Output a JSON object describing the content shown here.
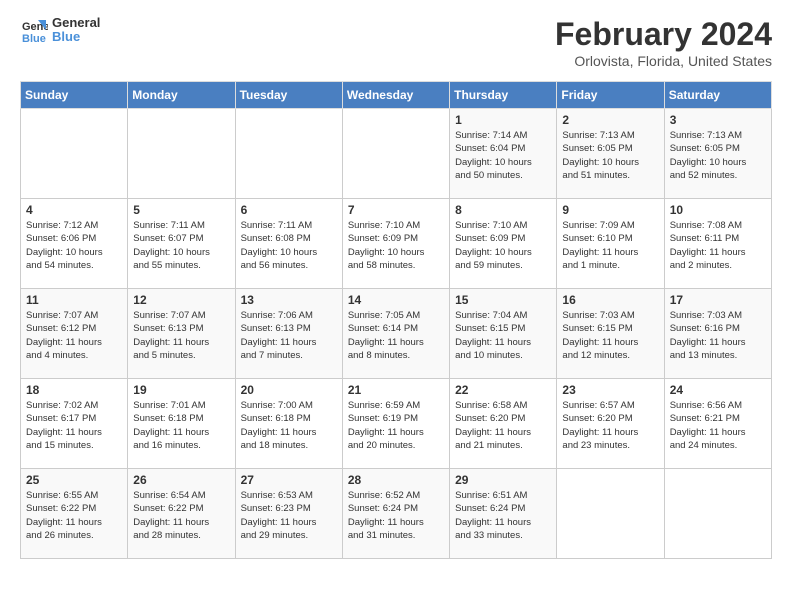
{
  "header": {
    "logo_line1": "General",
    "logo_line2": "Blue",
    "month_year": "February 2024",
    "location": "Orlovista, Florida, United States"
  },
  "days_of_week": [
    "Sunday",
    "Monday",
    "Tuesday",
    "Wednesday",
    "Thursday",
    "Friday",
    "Saturday"
  ],
  "weeks": [
    [
      {
        "num": "",
        "info": ""
      },
      {
        "num": "",
        "info": ""
      },
      {
        "num": "",
        "info": ""
      },
      {
        "num": "",
        "info": ""
      },
      {
        "num": "1",
        "info": "Sunrise: 7:14 AM\nSunset: 6:04 PM\nDaylight: 10 hours\nand 50 minutes."
      },
      {
        "num": "2",
        "info": "Sunrise: 7:13 AM\nSunset: 6:05 PM\nDaylight: 10 hours\nand 51 minutes."
      },
      {
        "num": "3",
        "info": "Sunrise: 7:13 AM\nSunset: 6:05 PM\nDaylight: 10 hours\nand 52 minutes."
      }
    ],
    [
      {
        "num": "4",
        "info": "Sunrise: 7:12 AM\nSunset: 6:06 PM\nDaylight: 10 hours\nand 54 minutes."
      },
      {
        "num": "5",
        "info": "Sunrise: 7:11 AM\nSunset: 6:07 PM\nDaylight: 10 hours\nand 55 minutes."
      },
      {
        "num": "6",
        "info": "Sunrise: 7:11 AM\nSunset: 6:08 PM\nDaylight: 10 hours\nand 56 minutes."
      },
      {
        "num": "7",
        "info": "Sunrise: 7:10 AM\nSunset: 6:09 PM\nDaylight: 10 hours\nand 58 minutes."
      },
      {
        "num": "8",
        "info": "Sunrise: 7:10 AM\nSunset: 6:09 PM\nDaylight: 10 hours\nand 59 minutes."
      },
      {
        "num": "9",
        "info": "Sunrise: 7:09 AM\nSunset: 6:10 PM\nDaylight: 11 hours\nand 1 minute."
      },
      {
        "num": "10",
        "info": "Sunrise: 7:08 AM\nSunset: 6:11 PM\nDaylight: 11 hours\nand 2 minutes."
      }
    ],
    [
      {
        "num": "11",
        "info": "Sunrise: 7:07 AM\nSunset: 6:12 PM\nDaylight: 11 hours\nand 4 minutes."
      },
      {
        "num": "12",
        "info": "Sunrise: 7:07 AM\nSunset: 6:13 PM\nDaylight: 11 hours\nand 5 minutes."
      },
      {
        "num": "13",
        "info": "Sunrise: 7:06 AM\nSunset: 6:13 PM\nDaylight: 11 hours\nand 7 minutes."
      },
      {
        "num": "14",
        "info": "Sunrise: 7:05 AM\nSunset: 6:14 PM\nDaylight: 11 hours\nand 8 minutes."
      },
      {
        "num": "15",
        "info": "Sunrise: 7:04 AM\nSunset: 6:15 PM\nDaylight: 11 hours\nand 10 minutes."
      },
      {
        "num": "16",
        "info": "Sunrise: 7:03 AM\nSunset: 6:15 PM\nDaylight: 11 hours\nand 12 minutes."
      },
      {
        "num": "17",
        "info": "Sunrise: 7:03 AM\nSunset: 6:16 PM\nDaylight: 11 hours\nand 13 minutes."
      }
    ],
    [
      {
        "num": "18",
        "info": "Sunrise: 7:02 AM\nSunset: 6:17 PM\nDaylight: 11 hours\nand 15 minutes."
      },
      {
        "num": "19",
        "info": "Sunrise: 7:01 AM\nSunset: 6:18 PM\nDaylight: 11 hours\nand 16 minutes."
      },
      {
        "num": "20",
        "info": "Sunrise: 7:00 AM\nSunset: 6:18 PM\nDaylight: 11 hours\nand 18 minutes."
      },
      {
        "num": "21",
        "info": "Sunrise: 6:59 AM\nSunset: 6:19 PM\nDaylight: 11 hours\nand 20 minutes."
      },
      {
        "num": "22",
        "info": "Sunrise: 6:58 AM\nSunset: 6:20 PM\nDaylight: 11 hours\nand 21 minutes."
      },
      {
        "num": "23",
        "info": "Sunrise: 6:57 AM\nSunset: 6:20 PM\nDaylight: 11 hours\nand 23 minutes."
      },
      {
        "num": "24",
        "info": "Sunrise: 6:56 AM\nSunset: 6:21 PM\nDaylight: 11 hours\nand 24 minutes."
      }
    ],
    [
      {
        "num": "25",
        "info": "Sunrise: 6:55 AM\nSunset: 6:22 PM\nDaylight: 11 hours\nand 26 minutes."
      },
      {
        "num": "26",
        "info": "Sunrise: 6:54 AM\nSunset: 6:22 PM\nDaylight: 11 hours\nand 28 minutes."
      },
      {
        "num": "27",
        "info": "Sunrise: 6:53 AM\nSunset: 6:23 PM\nDaylight: 11 hours\nand 29 minutes."
      },
      {
        "num": "28",
        "info": "Sunrise: 6:52 AM\nSunset: 6:24 PM\nDaylight: 11 hours\nand 31 minutes."
      },
      {
        "num": "29",
        "info": "Sunrise: 6:51 AM\nSunset: 6:24 PM\nDaylight: 11 hours\nand 33 minutes."
      },
      {
        "num": "",
        "info": ""
      },
      {
        "num": "",
        "info": ""
      }
    ]
  ]
}
